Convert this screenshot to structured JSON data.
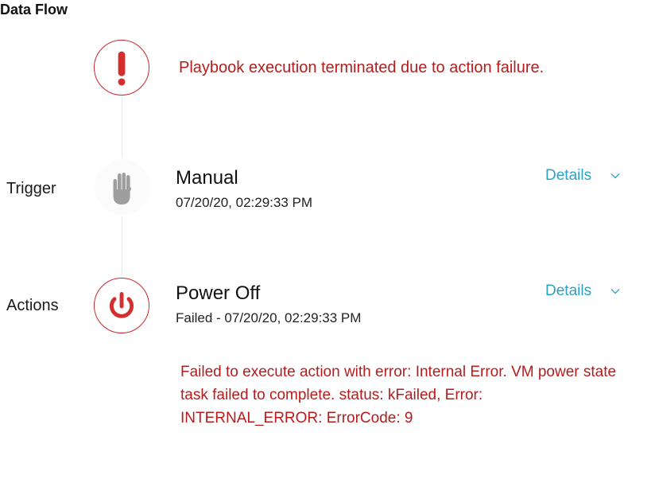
{
  "page": {
    "title": "Data Flow"
  },
  "alert": {
    "icon": "exclamation-icon",
    "message": "Playbook execution terminated due to action failure.",
    "color": "#c9262b"
  },
  "trigger": {
    "row_label": "Trigger",
    "icon": "hand-icon",
    "name": "Manual",
    "timestamp": "07/20/20, 02:29:33 PM",
    "details_label": "Details"
  },
  "action": {
    "row_label": "Actions",
    "icon": "power-icon",
    "name": "Power Off",
    "status_line": "Failed - 07/20/20, 02:29:33 PM",
    "details_label": "Details",
    "error_message": "Failed to execute action with error: Internal Error. VM power state task failed to complete. status: kFailed, Error: INTERNAL_ERROR: ErrorCode: 9"
  },
  "colors": {
    "error": "#b71c1c",
    "accent": "#2aa3c4"
  }
}
